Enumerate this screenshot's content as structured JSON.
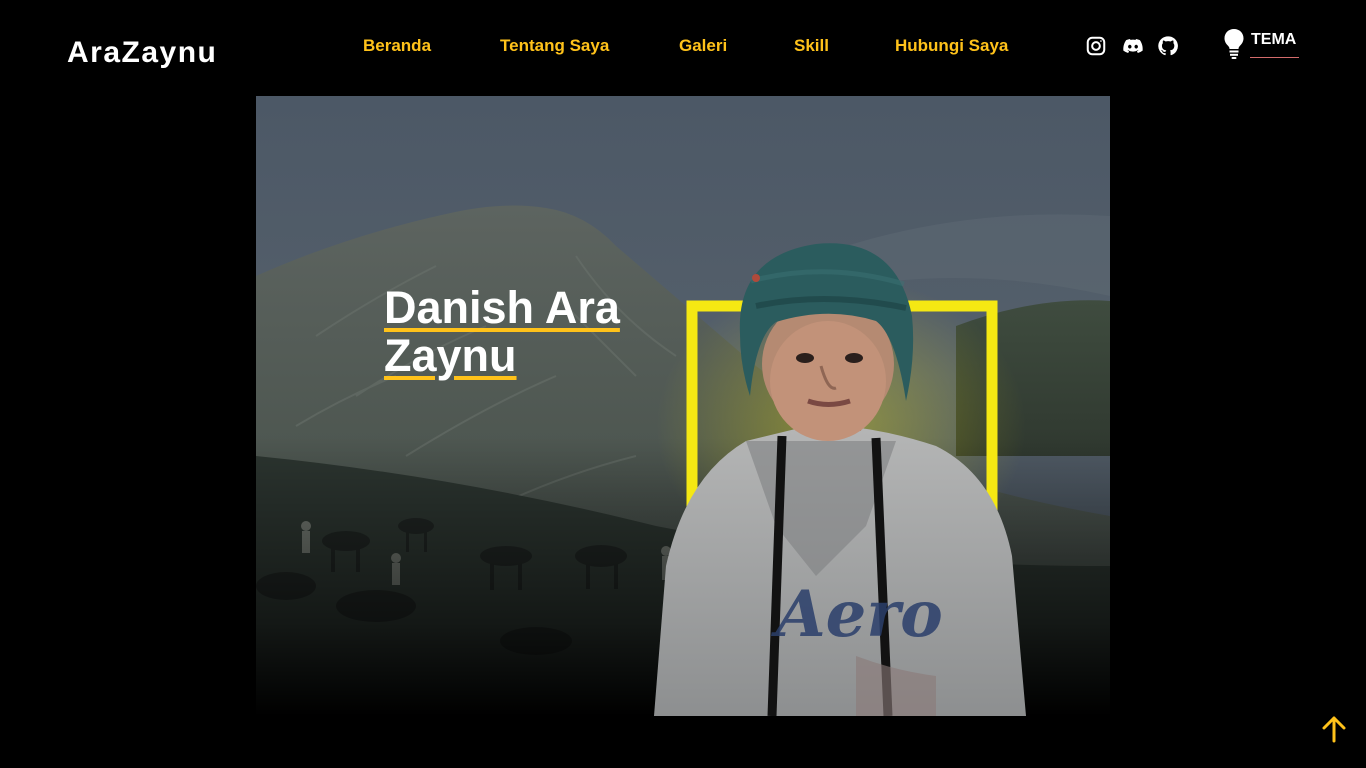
{
  "header": {
    "brand": "AraZaynu",
    "nav": [
      {
        "label": "Beranda"
      },
      {
        "label": "Tentang Saya"
      },
      {
        "label": "Galeri"
      },
      {
        "label": "Skill"
      },
      {
        "label": "Hubungi Saya"
      }
    ],
    "social": [
      {
        "icon": "instagram-icon"
      },
      {
        "icon": "discord-icon"
      },
      {
        "icon": "github-icon"
      }
    ],
    "theme_toggle": {
      "label": "TEMA",
      "icon": "lightbulb-icon"
    }
  },
  "hero": {
    "title": "Danish Ara Zaynu",
    "image": "portrait-in-front-of-mountain"
  },
  "scroll_top": {
    "icon": "arrow-up-icon"
  },
  "colors": {
    "background": "#000000",
    "accent": "#ffc21a",
    "frame": "#f5e813",
    "text": "#ffffff"
  }
}
